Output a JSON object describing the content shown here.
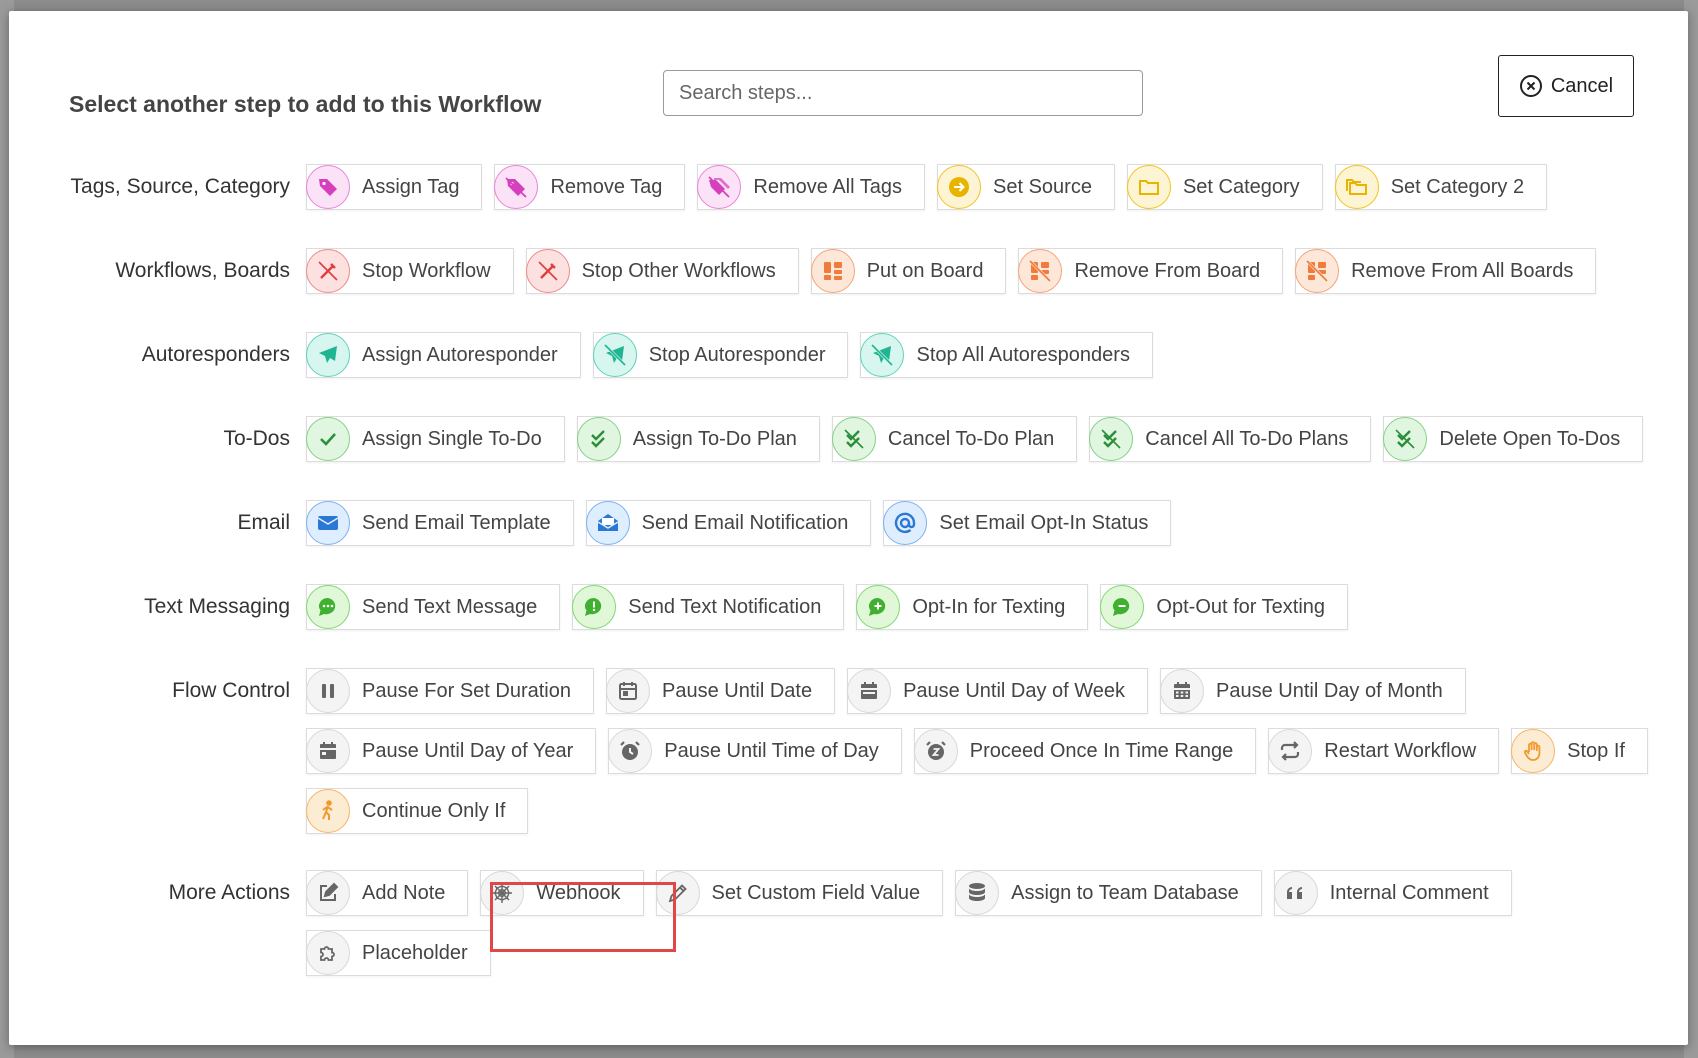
{
  "modal": {
    "title": "Select another step to add to this Workflow",
    "search_placeholder": "Search steps...",
    "cancel_label": "Cancel"
  },
  "categories": [
    {
      "label": "Tags, Source, Category",
      "steps": [
        "Assign Tag",
        "Remove Tag",
        "Remove All Tags",
        "Set Source",
        "Set Category",
        "Set Category 2"
      ]
    },
    {
      "label": "Workflows, Boards",
      "steps": [
        "Stop Workflow",
        "Stop Other Workflows",
        "Put on Board",
        "Remove From Board",
        "Remove From All Boards"
      ]
    },
    {
      "label": "Autoresponders",
      "steps": [
        "Assign Autoresponder",
        "Stop Autoresponder",
        "Stop All Autoresponders"
      ]
    },
    {
      "label": "To-Dos",
      "steps": [
        "Assign Single To-Do",
        "Assign To-Do Plan",
        "Cancel To-Do Plan",
        "Cancel All To-Do Plans",
        "Delete Open To-Dos"
      ]
    },
    {
      "label": "Email",
      "steps": [
        "Send Email Template",
        "Send Email Notification",
        "Set Email Opt-In Status"
      ]
    },
    {
      "label": "Text Messaging",
      "steps": [
        "Send Text Message",
        "Send Text Notification",
        "Opt-In for Texting",
        "Opt-Out for Texting"
      ]
    },
    {
      "label": "Flow Control",
      "steps": [
        "Pause For Set Duration",
        "Pause Until Date",
        "Pause Until Day of Week",
        "Pause Until Day of Month",
        "Pause Until Day of Year",
        "Pause Until Time of Day",
        "Proceed Once In Time Range",
        "Restart Workflow",
        "Stop If",
        "Continue Only If"
      ]
    },
    {
      "label": "More Actions",
      "steps": [
        "Add Note",
        "Webhook",
        "Set Custom Field Value",
        "Assign to Team Database",
        "Internal Comment",
        "Placeholder"
      ]
    }
  ]
}
